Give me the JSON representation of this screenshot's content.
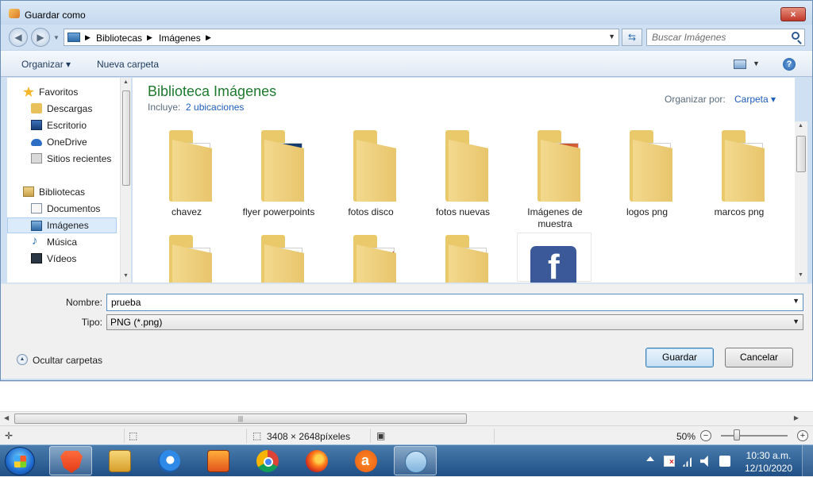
{
  "dialog": {
    "title": "Guardar como",
    "close_label": "×"
  },
  "address": {
    "breadcrumbs": [
      "Bibliotecas",
      "Imágenes"
    ],
    "search_placeholder": "Buscar Imágenes"
  },
  "toolbar": {
    "organize_label": "Organizar ▾",
    "new_folder_label": "Nueva carpeta"
  },
  "nav": {
    "favorites_label": "Favoritos",
    "favorites": [
      "Descargas",
      "Escritorio",
      "OneDrive",
      "Sitios recientes"
    ],
    "libraries_label": "Bibliotecas",
    "libraries": [
      "Documentos",
      "Imágenes",
      "Música",
      "Vídeos"
    ],
    "selected": "Imágenes"
  },
  "library": {
    "title": "Biblioteca Imágenes",
    "includes_label": "Incluye:",
    "locations_link": "2 ubicaciones",
    "arrange_label": "Organizar por:",
    "arrange_value": "Carpeta ▾"
  },
  "folders": [
    {
      "name": "chavez"
    },
    {
      "name": "flyer powerpoints"
    },
    {
      "name": "fotos disco"
    },
    {
      "name": "fotos nuevas"
    },
    {
      "name": "Imágenes de muestra"
    },
    {
      "name": "logos png"
    },
    {
      "name": "marcos png"
    }
  ],
  "form": {
    "name_label": "Nombre:",
    "name_value": "prueba",
    "type_label": "Tipo:",
    "type_value": "PNG (*.png)",
    "hide_folders_label": "Ocultar carpetas",
    "save_label": "Guardar",
    "cancel_label": "Cancelar"
  },
  "statusbar": {
    "dimensions": "3408 × 2648píxeles",
    "zoom": "50%"
  },
  "taskbar": {
    "time": "10:30 a.m.",
    "date": "12/10/2020",
    "apps": [
      "brave",
      "explorer",
      "internet-explorer",
      "media-player",
      "chrome",
      "firefox",
      "avast",
      "paint"
    ]
  }
}
